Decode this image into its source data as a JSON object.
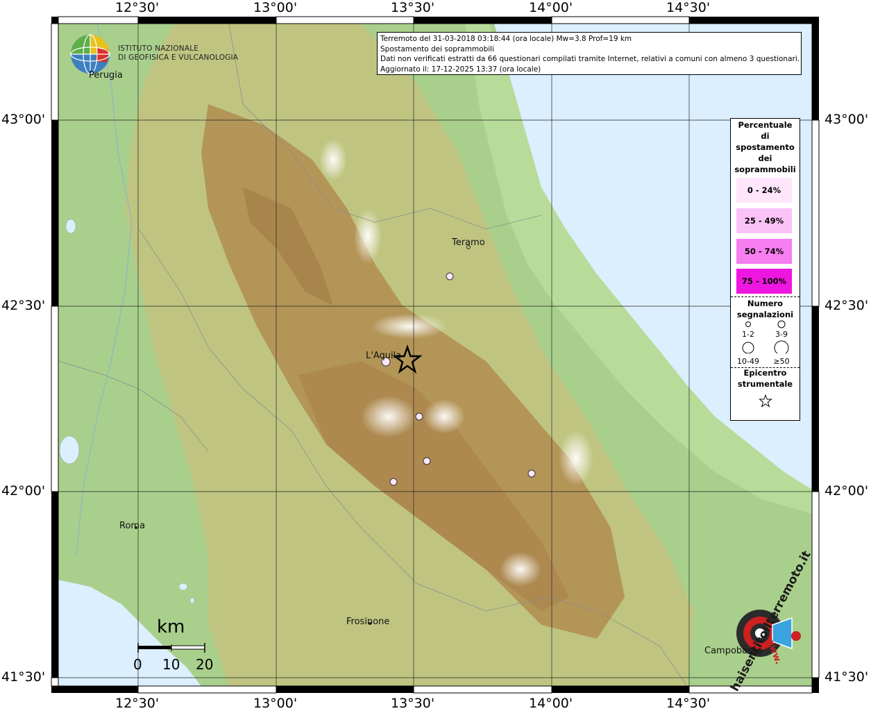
{
  "map": {
    "top_ticks": [
      "12°30'",
      "13°00'",
      "13°30'",
      "14°00'",
      "14°30'"
    ],
    "bottom_ticks": [
      "12°30'",
      "13°00'",
      "13°30'",
      "14°00'",
      "14°30'"
    ],
    "left_ticks": [
      "43°00'",
      "42°30'",
      "42°00'",
      "41°30'"
    ],
    "right_ticks": [
      "43°00'",
      "42°30'",
      "42°00'",
      "41°30'"
    ]
  },
  "cities": {
    "perugia": "Perugia",
    "teramo": "Teramo",
    "laquila": "L'Aquila",
    "roma": "Roma",
    "frosinone": "Frosinone",
    "campobasso": "Campobasso"
  },
  "header": {
    "line1": "Terremoto del 31-03-2018 03:18:44 (ora locale) Mw=3.8 Prof=19 km",
    "line2": "Spostamento dei soprammobili",
    "line3": "Dati non verificati estratti da 66 questionari compilati tramite Internet, relativi a comuni con almeno 3 questionari.",
    "line4": "Aggiornato il: 17-12-2025 13:37 (ora locale)"
  },
  "logo": {
    "line1": "ISTITUTO NAZIONALE",
    "line2": "DI GEOFISICA E VULCANOLOGIA"
  },
  "legend": {
    "title1": "Percentuale",
    "title2": "di",
    "title3": "spostamento",
    "title4": "dei",
    "title5": "soprammobili",
    "classes": [
      {
        "label": "0 - 24%",
        "color": "#ffe6fb"
      },
      {
        "label": "25 - 49%",
        "color": "#fbc2f7"
      },
      {
        "label": "50 - 74%",
        "color": "#f77ef0"
      },
      {
        "label": "75 - 100%",
        "color": "#ee16e0"
      }
    ],
    "count_title1": "Numero",
    "count_title2": "segnalazioni",
    "count_labels": [
      "1-2",
      "3-9",
      "10-49",
      "≥50"
    ],
    "epi_title1": "Epicentro",
    "epi_title2": "strumentale"
  },
  "scale": {
    "unit": "km",
    "ticks": [
      "0",
      "10",
      "20"
    ]
  },
  "watermark": {
    "main": "haisentitoilterremoto.it",
    "sub": "www."
  },
  "observations": [
    {
      "place": "Teramo area",
      "pct_class": "0 - 24%"
    },
    {
      "place": "L'Aquila",
      "pct_class": "0 - 24%"
    },
    {
      "place": "south of L'Aquila",
      "pct_class": "0 - 24%"
    },
    {
      "place": "south of L'Aquila 2",
      "pct_class": "0 - 24%"
    },
    {
      "place": "south-west",
      "pct_class": "0 - 24%"
    },
    {
      "place": "east",
      "pct_class": "0 - 24%"
    }
  ],
  "colors": {
    "sea": "#dcefff",
    "lowland": "#a6cf8a",
    "hills": "#c9c07c",
    "mountains": "#b18a4c",
    "peaks": "#f5f1f0"
  }
}
